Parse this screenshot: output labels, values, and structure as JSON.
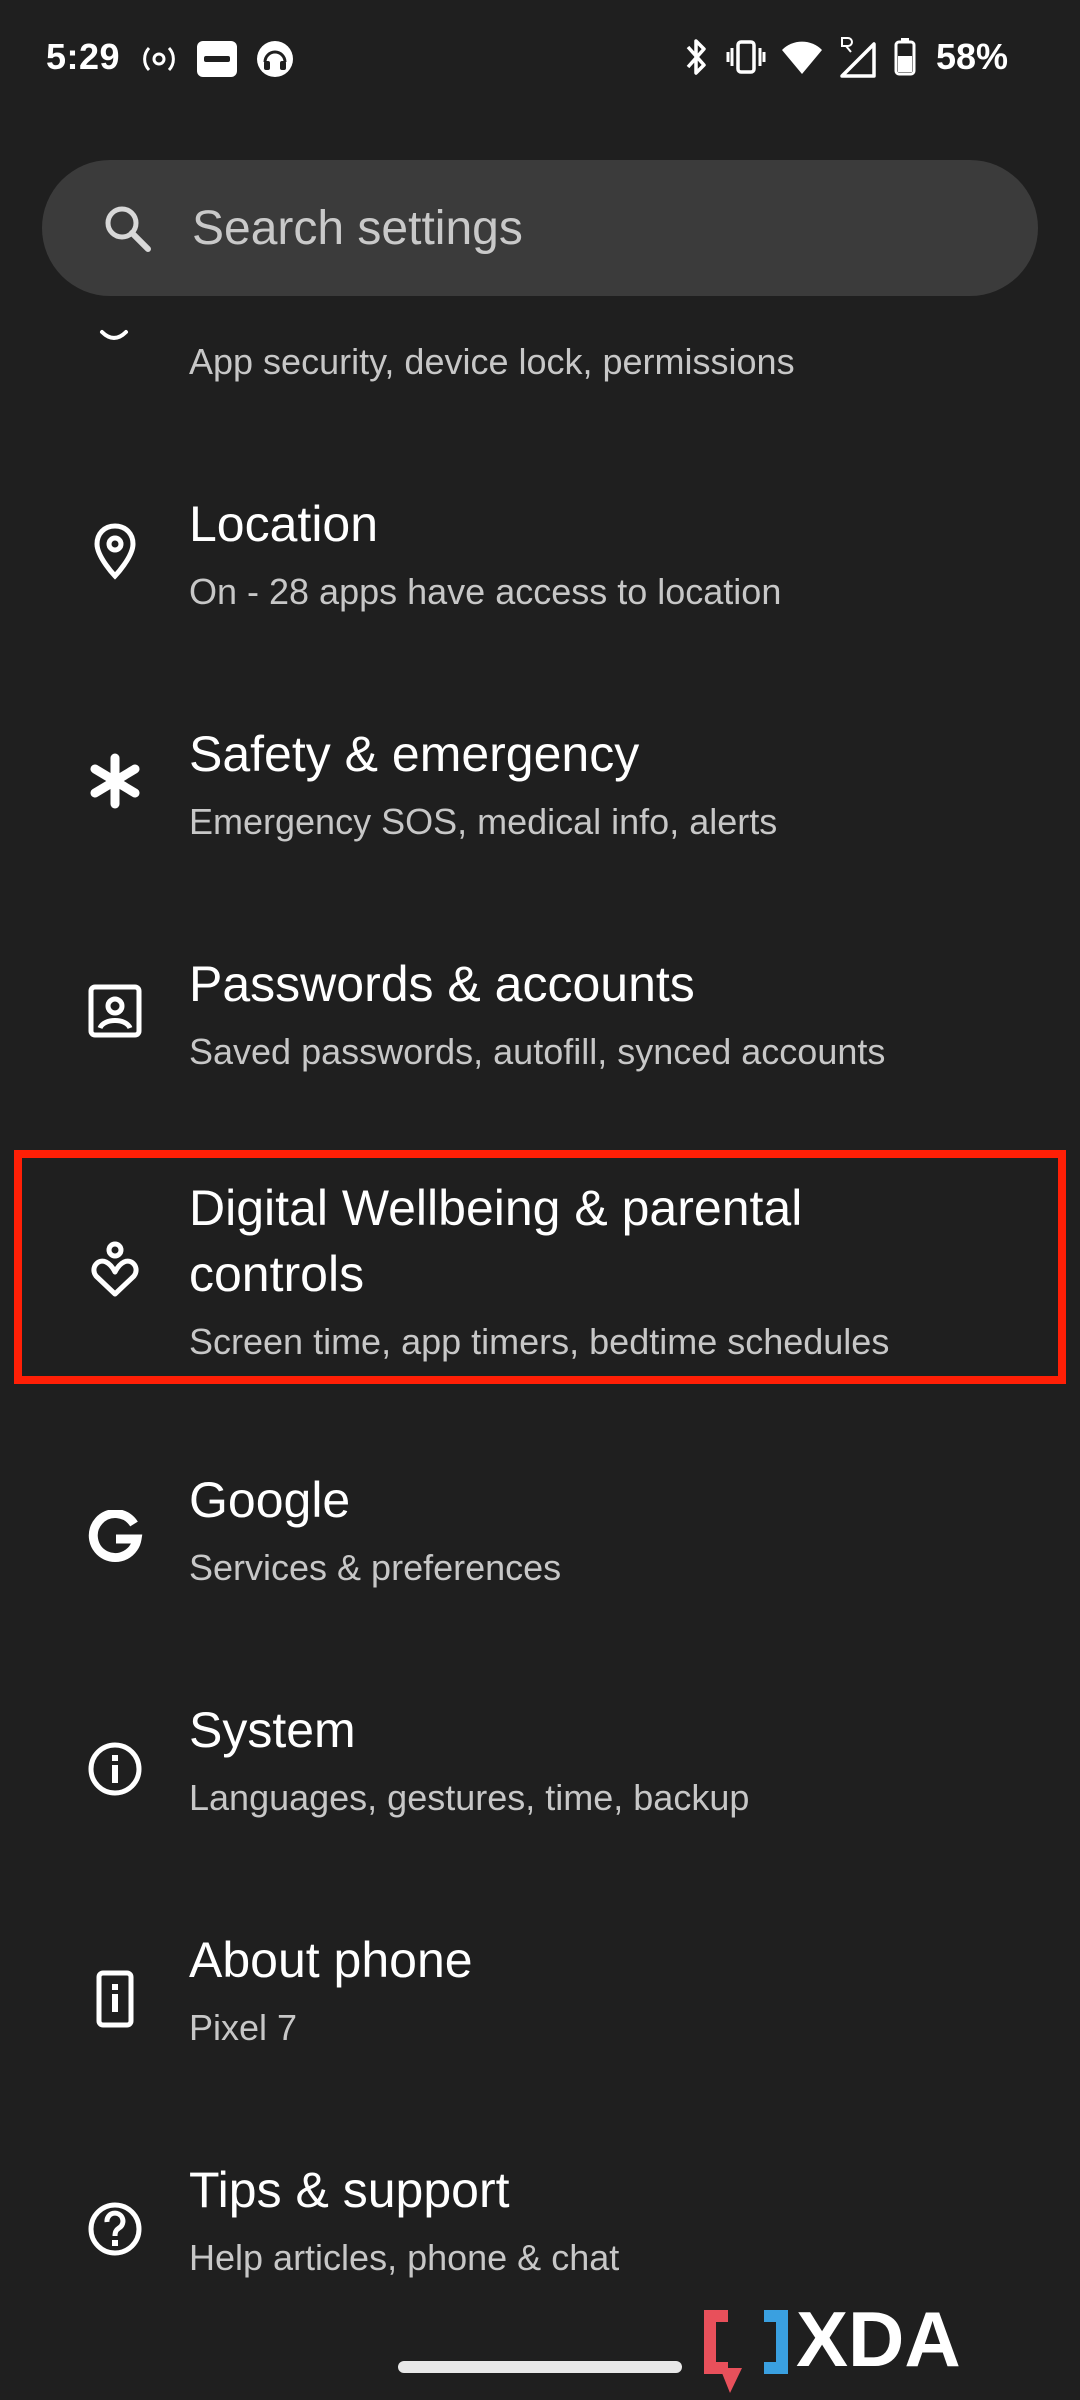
{
  "status_bar": {
    "time": "5:29",
    "battery_percent": "58%",
    "left_icons": [
      "hotspot-icon",
      "paytm-icon",
      "headset-icon"
    ],
    "right_icons": [
      "bluetooth-icon",
      "vibrate-icon",
      "wifi-icon",
      "signal-roaming-icon",
      "battery-icon"
    ]
  },
  "search": {
    "placeholder": "Search settings"
  },
  "items": [
    {
      "icon": "lock-icon",
      "title": "",
      "subtitle": "App security, device lock, permissions"
    },
    {
      "icon": "location-pin-icon",
      "title": "Location",
      "subtitle": "On - 28 apps have access to location"
    },
    {
      "icon": "asterisk-icon",
      "title": "Safety & emergency",
      "subtitle": "Emergency SOS, medical info, alerts"
    },
    {
      "icon": "account-box-icon",
      "title": "Passwords & accounts",
      "subtitle": "Saved passwords, autofill, synced accounts"
    },
    {
      "icon": "digital-wellbeing-icon",
      "title_line1": "Digital Wellbeing & parental",
      "title_line2": "controls",
      "subtitle": "Screen time, app timers, bedtime schedules",
      "highlighted": true
    },
    {
      "icon": "google-g-icon",
      "title": "Google",
      "subtitle": "Services & preferences"
    },
    {
      "icon": "info-icon",
      "title": "System",
      "subtitle": "Languages, gestures, time, backup"
    },
    {
      "icon": "phone-info-icon",
      "title": "About phone",
      "subtitle": "Pixel 7"
    },
    {
      "icon": "help-icon",
      "title": "Tips & support",
      "subtitle": "Help articles, phone & chat"
    }
  ],
  "colors": {
    "background": "#1f1f1f",
    "search_bg": "#3b3b3b",
    "highlight_border": "#ff1f06",
    "subtitle_text": "#c7c7c7"
  },
  "watermark": {
    "text": "XDA"
  }
}
